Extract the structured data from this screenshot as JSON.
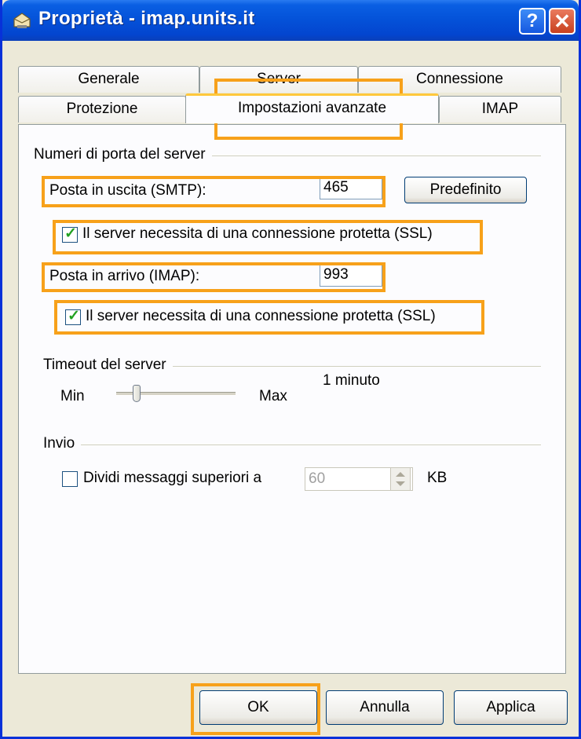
{
  "window": {
    "title": "Proprietà - imap.units.it",
    "help_glyph": "?",
    "close_glyph": "✕"
  },
  "tabs": {
    "back_row": [
      "Generale",
      "Server",
      "Connessione"
    ],
    "front_row": [
      "Protezione",
      "Impostazioni avanzate",
      "IMAP"
    ],
    "active": "Impostazioni avanzate"
  },
  "ports": {
    "group_label": "Numeri di porta del server",
    "smtp_label": "Posta in uscita (SMTP):",
    "smtp_value": "465",
    "default_button": "Predefinito",
    "smtp_ssl_label": "Il server necessita di una connessione protetta (SSL)",
    "smtp_ssl_checked": true,
    "imap_label": "Posta in arrivo (IMAP):",
    "imap_value": "993",
    "imap_ssl_label": "Il server necessita di una connessione protetta (SSL)",
    "imap_ssl_checked": true
  },
  "timeout": {
    "group_label": "Timeout del server",
    "min_label": "Min",
    "max_label": "Max",
    "value_text": "1 minuto",
    "slider_level": 0.15
  },
  "send": {
    "group_label": "Invio",
    "split_label": "Dividi messaggi superiori a",
    "split_checked": false,
    "split_value": "60",
    "unit": "KB"
  },
  "footer": {
    "ok": "OK",
    "cancel": "Annulla",
    "apply": "Applica"
  },
  "colors": {
    "highlight": "#f7a11a",
    "title_bar": "#0451d8",
    "check": "#21a121"
  },
  "icons": [
    "mailbox-icon",
    "help-icon",
    "close-icon",
    "checkmark-icon",
    "spin-up-icon",
    "spin-down-icon"
  ]
}
